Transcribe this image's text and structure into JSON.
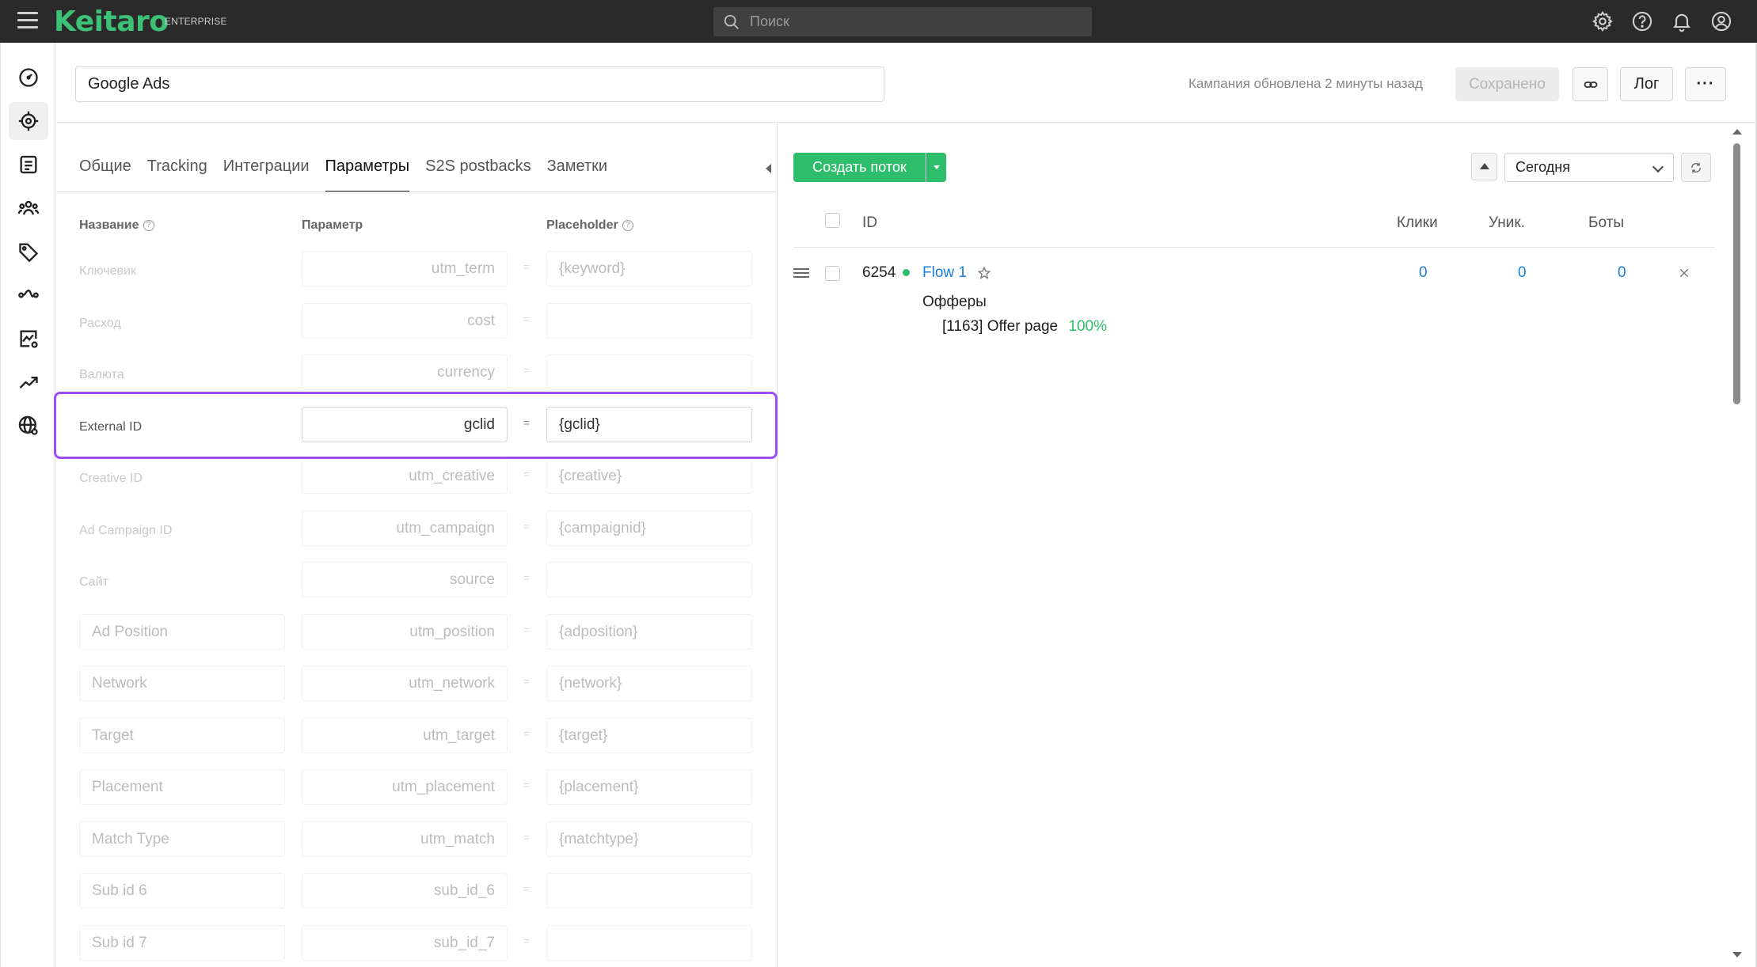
{
  "topbar": {
    "logo": "Keitaro",
    "edition": "ENTERPRISE",
    "search_placeholder": "Поиск",
    "icons": [
      "settings-icon",
      "help-icon",
      "bell-icon",
      "user-icon"
    ]
  },
  "sidebar": {
    "items": [
      {
        "name": "dashboard",
        "icon": "speedometer-icon"
      },
      {
        "name": "campaigns",
        "icon": "target-icon",
        "active": true
      },
      {
        "name": "offers",
        "icon": "document-icon"
      },
      {
        "name": "affiliate-networks",
        "icon": "people-icon"
      },
      {
        "name": "sources",
        "icon": "price-tag-icon"
      },
      {
        "name": "flows",
        "icon": "route-icon"
      },
      {
        "name": "reports",
        "icon": "chart-gear-icon"
      },
      {
        "name": "trends",
        "icon": "trend-up-icon"
      },
      {
        "name": "domains",
        "icon": "globe-gear-icon"
      }
    ]
  },
  "header": {
    "campaign_name": "Google Ads",
    "updated_text": "Кампания обновлена 2 минуты назад",
    "saved_label": "Сохранено",
    "log_label": "Лог",
    "more_label": "···"
  },
  "tabs": [
    {
      "label": "Общие"
    },
    {
      "label": "Tracking"
    },
    {
      "label": "Интеграции"
    },
    {
      "label": "Параметры",
      "active": true
    },
    {
      "label": "S2S postbacks"
    },
    {
      "label": "Заметки"
    }
  ],
  "params": {
    "headers": {
      "name": "Название",
      "param": "Параметр",
      "placeholder": "Placeholder"
    },
    "eq": "=",
    "rows": [
      {
        "label": "Ключевик",
        "param": "utm_term",
        "placeholder": "{keyword}",
        "editable_name": false,
        "faded": true
      },
      {
        "label": "Расход",
        "param": "cost",
        "placeholder": "",
        "editable_name": false,
        "faded": true
      },
      {
        "label": "Валюта",
        "param": "currency",
        "placeholder": "",
        "editable_name": false,
        "faded": true
      },
      {
        "label": "External ID",
        "param": "gclid",
        "placeholder": "{gclid}",
        "editable_name": false,
        "faded": false
      },
      {
        "label": "Creative ID",
        "param": "utm_creative",
        "placeholder": "{creative}",
        "editable_name": false,
        "faded": true
      },
      {
        "label": "Ad Campaign ID",
        "param": "utm_campaign",
        "placeholder": "{campaignid}",
        "editable_name": false,
        "faded": true
      },
      {
        "label": "Сайт",
        "param": "source",
        "placeholder": "",
        "editable_name": false,
        "faded": true
      },
      {
        "label": "Ad Position",
        "param": "utm_position",
        "placeholder": "{adposition}",
        "editable_name": true,
        "faded": true
      },
      {
        "label": "Network",
        "param": "utm_network",
        "placeholder": "{network}",
        "editable_name": true,
        "faded": true
      },
      {
        "label": "Target",
        "param": "utm_target",
        "placeholder": "{target}",
        "editable_name": true,
        "faded": true
      },
      {
        "label": "Placement",
        "param": "utm_placement",
        "placeholder": "{placement}",
        "editable_name": true,
        "faded": true
      },
      {
        "label": "Match Type",
        "param": "utm_match",
        "placeholder": "{matchtype}",
        "editable_name": true,
        "faded": true
      },
      {
        "label": "Sub id 6",
        "param": "sub_id_6",
        "placeholder": "",
        "editable_name": true,
        "faded": true
      },
      {
        "label": "Sub id 7",
        "param": "sub_id_7",
        "placeholder": "",
        "editable_name": true,
        "faded": true
      }
    ]
  },
  "streams": {
    "create_label": "Создать поток",
    "period": "Сегодня",
    "columns": {
      "id": "ID",
      "clicks": "Клики",
      "unique": "Уник.",
      "bots": "Боты"
    },
    "flows": [
      {
        "id": "6254",
        "name": "Flow 1",
        "clicks": "0",
        "unique": "0",
        "bots": "0",
        "offers_label": "Офферы",
        "offer": "[1163] Offer page",
        "offer_share": "100%"
      }
    ]
  }
}
